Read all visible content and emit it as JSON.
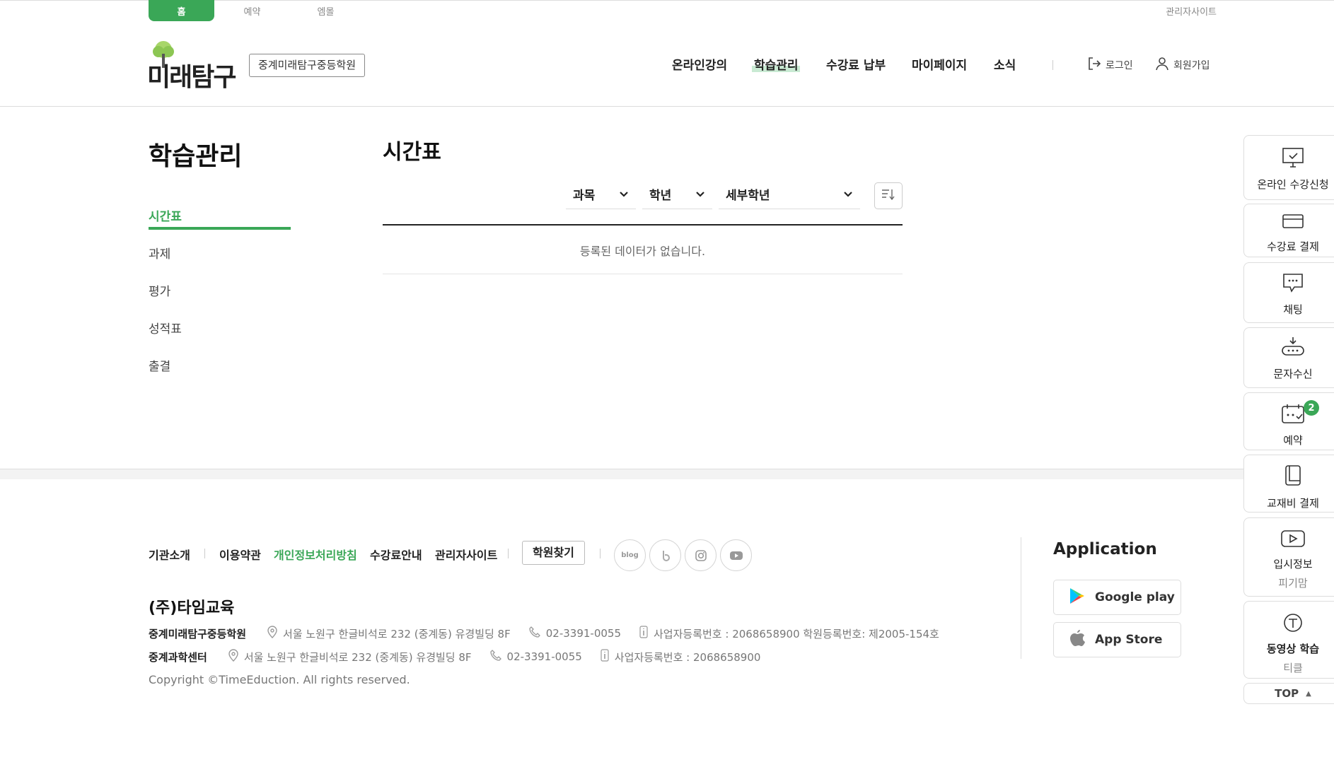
{
  "utility": {
    "tabs": [
      "홈",
      "예약",
      "엠몰"
    ],
    "admin_link": "관리자사이트"
  },
  "header": {
    "logo_text": "미래탐구",
    "academy": "중계미래탐구중등학원",
    "nav": [
      "온라인강의",
      "학습관리",
      "수강료 납부",
      "마이페이지",
      "소식"
    ],
    "active_nav": "학습관리",
    "login": "로그인",
    "signup": "회원가입"
  },
  "sidebar": {
    "title": "학습관리",
    "items": [
      "시간표",
      "과제",
      "평가",
      "성적표",
      "출결"
    ],
    "active": "시간표"
  },
  "main": {
    "title": "시간표",
    "filters": [
      "과목",
      "학년",
      "세부학년"
    ],
    "empty_message": "등록된 데이터가 없습니다."
  },
  "footer": {
    "links": [
      "기관소개",
      "이용약관",
      "개인정보처리방침",
      "수강료안내",
      "관리자사이트"
    ],
    "find_button": "학원찾기",
    "sns": [
      "blog",
      "band-icon",
      "instagram-icon",
      "youtube-icon"
    ],
    "sns_blog_label": "blog",
    "company": "(주)타임교육",
    "branches": [
      {
        "name": "중계미래탐구중등학원",
        "address": "서울 노원구 한글비석로 232 (중계동) 유경빌딩 8F",
        "phone": "02-3391-0055",
        "info": "사업자등록번호 : 2068658900  학원등록번호: 제2005-154호"
      },
      {
        "name": "중계과학센터",
        "address": "서울 노원구 한글비석로 232 (중계동) 유경빌딩 8F",
        "phone": "02-3391-0055",
        "info": "사업자등록번호 : 2068658900"
      }
    ],
    "copyright": "Copyright ©TimeEduction. All rights reserved.",
    "app_title": "Application",
    "stores": [
      "Google play",
      "App Store"
    ]
  },
  "quick_menu": {
    "items": [
      {
        "label": "온라인 수강신청",
        "sub": ""
      },
      {
        "label": "수강료 결제",
        "sub": ""
      },
      {
        "label": "채팅",
        "sub": ""
      },
      {
        "label": "문자수신",
        "sub": ""
      },
      {
        "label": "예약",
        "sub": "",
        "badge": "2"
      },
      {
        "label": "교재비 결제",
        "sub": ""
      },
      {
        "label": "입시정보",
        "sub": "피기맘"
      },
      {
        "label": "동영상 학습",
        "sub": "티클"
      }
    ],
    "top": "TOP"
  },
  "colors": {
    "accent": "#3aa757",
    "accent_light": "#c9ead3"
  }
}
